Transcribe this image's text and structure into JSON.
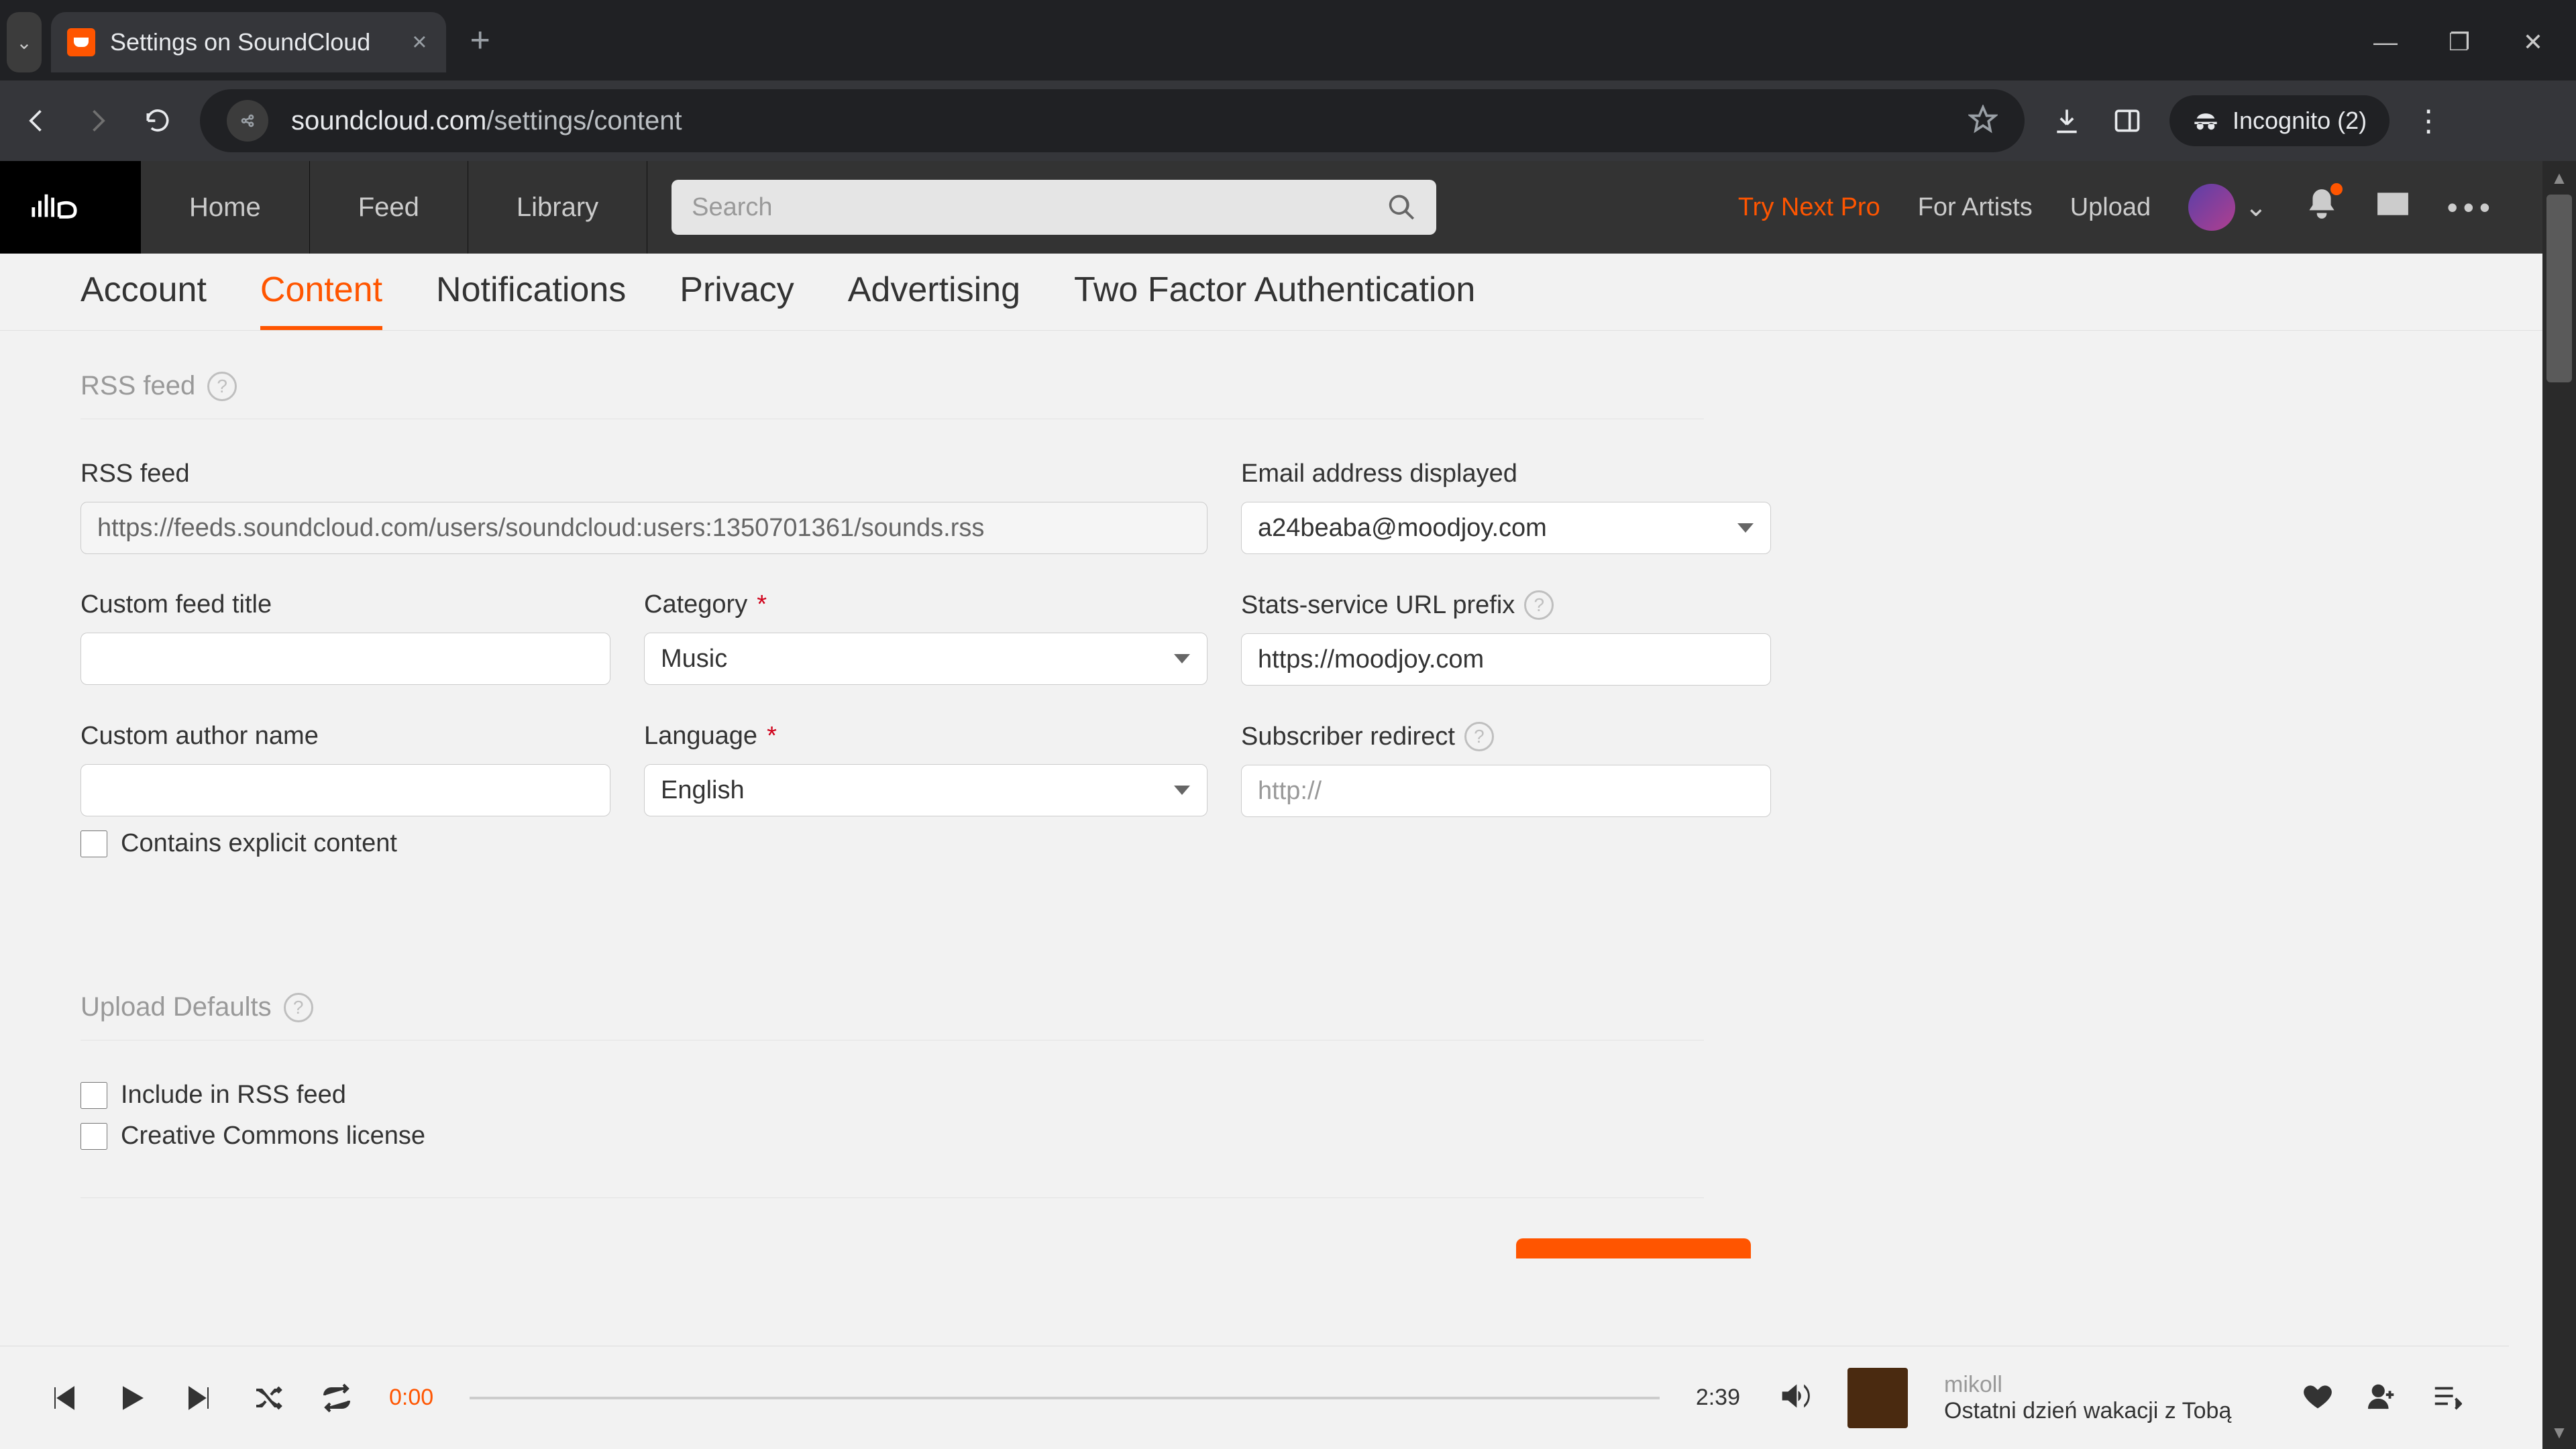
{
  "browser": {
    "tab_title": "Settings on SoundCloud",
    "url_host": "soundcloud.com",
    "url_path": "/settings/content",
    "incognito_label": "Incognito (2)"
  },
  "header": {
    "nav": {
      "home": "Home",
      "feed": "Feed",
      "library": "Library"
    },
    "search_placeholder": "Search",
    "try_pro": "Try Next Pro",
    "for_artists": "For Artists",
    "upload": "Upload"
  },
  "tabs": {
    "account": "Account",
    "content": "Content",
    "notifications": "Notifications",
    "privacy": "Privacy",
    "advertising": "Advertising",
    "two_factor": "Two Factor Authentication"
  },
  "rss": {
    "section": "RSS feed",
    "feed_label": "RSS feed",
    "feed_value": "https://feeds.soundcloud.com/users/soundcloud:users:1350701361/sounds.rss",
    "email_label": "Email address displayed",
    "email_value": "a24beaba@moodjoy.com",
    "title_label": "Custom feed title",
    "title_value": "",
    "category_label": "Category",
    "category_value": "Music",
    "stats_label": "Stats-service URL prefix",
    "stats_value": "https://moodjoy.com",
    "author_label": "Custom author name",
    "author_value": "",
    "language_label": "Language",
    "language_value": "English",
    "redirect_label": "Subscriber redirect",
    "redirect_placeholder": "http://",
    "explicit_label": "Contains explicit content"
  },
  "upload_defaults": {
    "section": "Upload Defaults",
    "include_rss": "Include in RSS feed",
    "cc_license": "Creative Commons license"
  },
  "player": {
    "elapsed": "0:00",
    "duration": "2:39",
    "artist": "mikoll",
    "title": "Ostatni dzień wakacji z Tobą"
  }
}
